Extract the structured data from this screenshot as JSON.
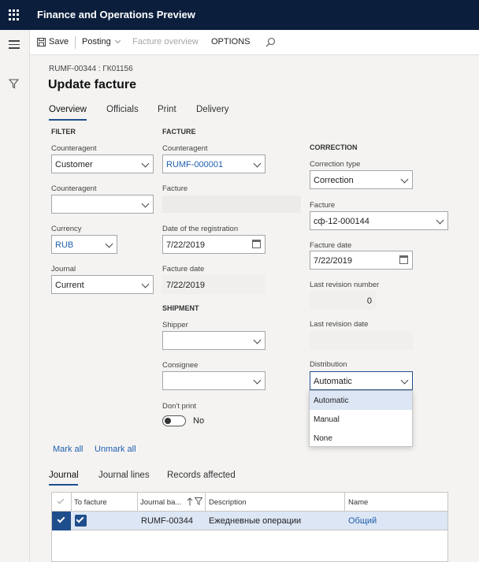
{
  "app": {
    "title": "Finance and Operations Preview"
  },
  "actionbar": {
    "save": "Save",
    "posting": "Posting",
    "facture_overview": "Facture overview",
    "options": "OPTIONS"
  },
  "page": {
    "breadcrumb": "RUMF-00344 : ГК01156",
    "title": "Update facture"
  },
  "tabs": [
    "Overview",
    "Officials",
    "Print",
    "Delivery"
  ],
  "filter": {
    "section": "FILTER",
    "counteragent1_label": "Counteragent",
    "counteragent1_value": "Customer",
    "counteragent2_label": "Counteragent",
    "counteragent2_value": "",
    "currency_label": "Currency",
    "currency_value": "RUB",
    "journal_label": "Journal",
    "journal_value": "Current"
  },
  "facture": {
    "section": "FACTURE",
    "counteragent_label": "Counteragent",
    "counteragent_value": "RUMF-000001",
    "facture_label": "Facture",
    "facture_value": "",
    "reg_date_label": "Date of the registration",
    "reg_date_value": "7/22/2019",
    "facture_date_label": "Facture date",
    "facture_date_value": "7/22/2019"
  },
  "shipment": {
    "section": "SHIPMENT",
    "shipper_label": "Shipper",
    "consignee_label": "Consignee",
    "dont_print_label": "Don't print",
    "dont_print_value": "No"
  },
  "correction": {
    "section": "CORRECTION",
    "type_label": "Correction type",
    "type_value": "Correction",
    "facture_label": "Facture",
    "facture_value": "сф-12-000144",
    "facture_date_label": "Facture date",
    "facture_date_value": "7/22/2019",
    "last_rev_number_label": "Last revision number",
    "last_rev_number_value": "0",
    "last_rev_date_label": "Last revision date",
    "distribution_label": "Distribution",
    "distribution_value": "Automatic",
    "distribution_options": [
      "Automatic",
      "Manual",
      "None"
    ]
  },
  "marks": {
    "mark_all": "Mark all",
    "unmark_all": "Unmark all"
  },
  "bottom_tabs": [
    "Journal",
    "Journal lines",
    "Records affected"
  ],
  "grid": {
    "headers": [
      "To facture",
      "Journal ba...",
      "Description",
      "Name"
    ],
    "rows": [
      {
        "journal": "RUMF-00344",
        "description": "Ежедневные операции",
        "name": "Общий"
      }
    ]
  },
  "colors": {
    "topbar": "#0b1f3d",
    "accent": "#1f4e8c",
    "link": "#1f5fae",
    "selected_row": "#dce6f4"
  }
}
